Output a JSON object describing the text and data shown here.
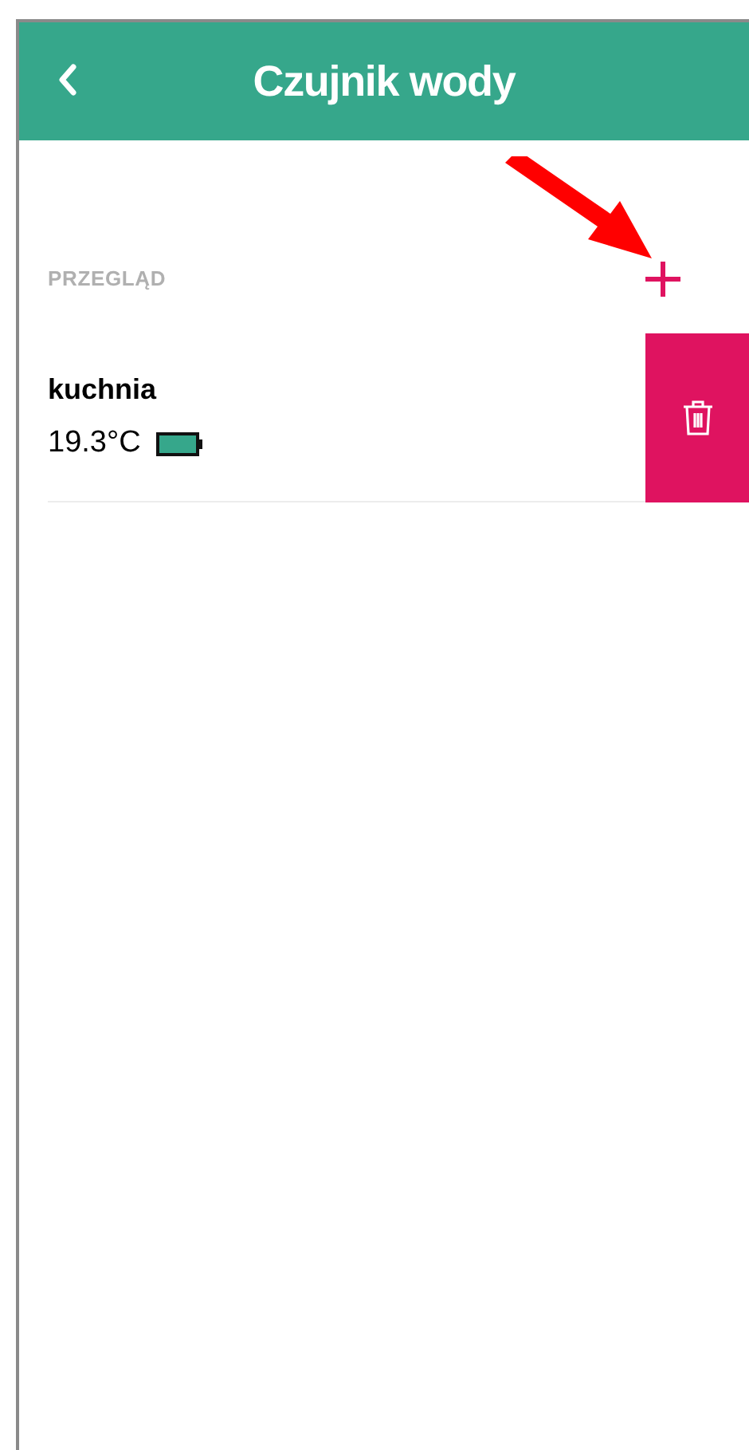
{
  "header": {
    "title": "Czujnik wody"
  },
  "section": {
    "label": "PRZEGLĄD"
  },
  "sensors": [
    {
      "name": "kuchnia",
      "temperature": "19.3°C",
      "swiped": true
    }
  ]
}
